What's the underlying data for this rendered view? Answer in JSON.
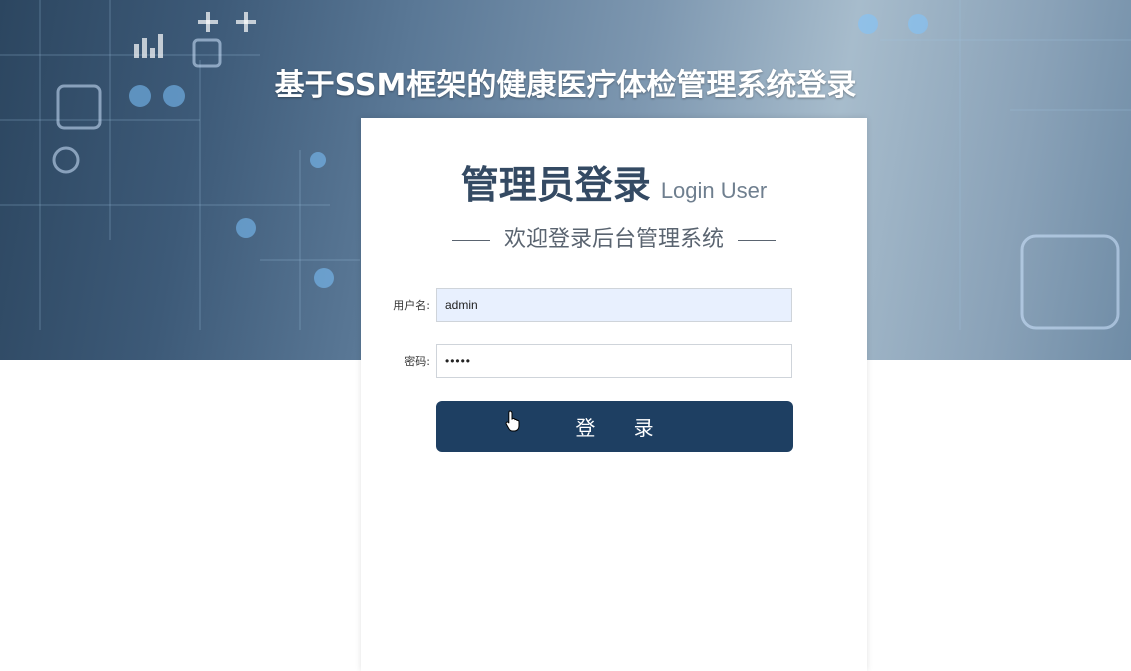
{
  "site_title": "基于SSM框架的健康医疗体检管理系统登录",
  "panel": {
    "heading": "管理员登录",
    "heading_sub": "Login User",
    "welcome": "欢迎登录后台管理系统"
  },
  "form": {
    "username_label": "用户名:",
    "username_value": "admin",
    "password_label": "密码:",
    "password_value": "•••••",
    "login_label": "登 录"
  },
  "colors": {
    "button": "#1e3f62",
    "heading": "#344a63"
  }
}
